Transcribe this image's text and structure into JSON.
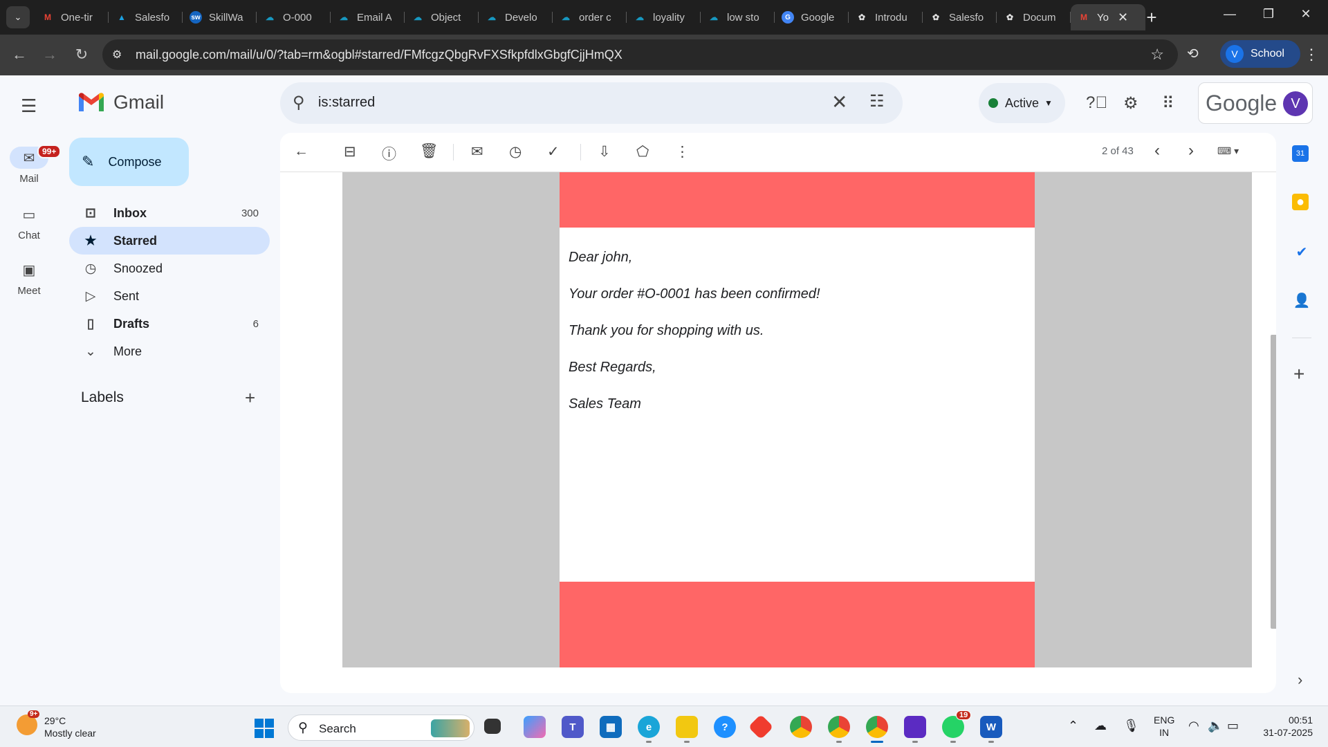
{
  "browser": {
    "tabs": [
      {
        "label": "One-tir",
        "icon": "gmail-icon"
      },
      {
        "label": "Salesfo",
        "icon": "trailhead-icon"
      },
      {
        "label": "SkillWa",
        "icon": "skillwallet-icon"
      },
      {
        "label": "O-000",
        "icon": "salesforce-icon"
      },
      {
        "label": "Email A",
        "icon": "salesforce-icon"
      },
      {
        "label": "Object",
        "icon": "salesforce-icon"
      },
      {
        "label": "Develo",
        "icon": "salesforce-icon"
      },
      {
        "label": "order c",
        "icon": "salesforce-icon"
      },
      {
        "label": "loyality",
        "icon": "salesforce-icon"
      },
      {
        "label": "low sto",
        "icon": "salesforce-icon"
      },
      {
        "label": "Google",
        "icon": "google-lens-icon"
      },
      {
        "label": "Introdu",
        "icon": "openai-icon"
      },
      {
        "label": "Salesfo",
        "icon": "openai-icon"
      },
      {
        "label": "Docum",
        "icon": "openai-icon"
      },
      {
        "label": "Yo",
        "icon": "gmail-icon"
      }
    ],
    "url": "mail.google.com/mail/u/0/?tab=rm&ogbl#starred/FMfcgzQbgRvFXSfkpfdlxGbgfCjjHmQX",
    "profile_initial": "V",
    "profile_label": "School"
  },
  "gmail": {
    "app_name": "Gmail",
    "rail": [
      {
        "label": "Mail",
        "badge": "99+"
      },
      {
        "label": "Chat"
      },
      {
        "label": "Meet"
      }
    ],
    "compose_label": "Compose",
    "folders": [
      {
        "label": "Inbox",
        "count": "300"
      },
      {
        "label": "Starred",
        "count": ""
      },
      {
        "label": "Snoozed",
        "count": ""
      },
      {
        "label": "Sent",
        "count": ""
      },
      {
        "label": "Drafts",
        "count": "6"
      },
      {
        "label": "More",
        "count": ""
      }
    ],
    "labels_heading": "Labels",
    "search_value": "is:starred",
    "status_label": "Active",
    "google_wordmark": "Google",
    "account_initial": "V",
    "pager": "2 of 43"
  },
  "email": {
    "lines": [
      "Dear john,",
      "Your order #O-0001 has been confirmed!",
      "Thank you for shopping with us.",
      "Best Regards,",
      "Sales Team"
    ],
    "band_color": "#ff6666"
  },
  "taskbar": {
    "temperature": "29°C",
    "weather": "Mostly clear",
    "weather_badge": "9+",
    "search_label": "Search",
    "whatsapp_badge": "19",
    "lang_1": "ENG",
    "lang_2": "IN",
    "time": "00:51",
    "date": "31-07-2025"
  }
}
